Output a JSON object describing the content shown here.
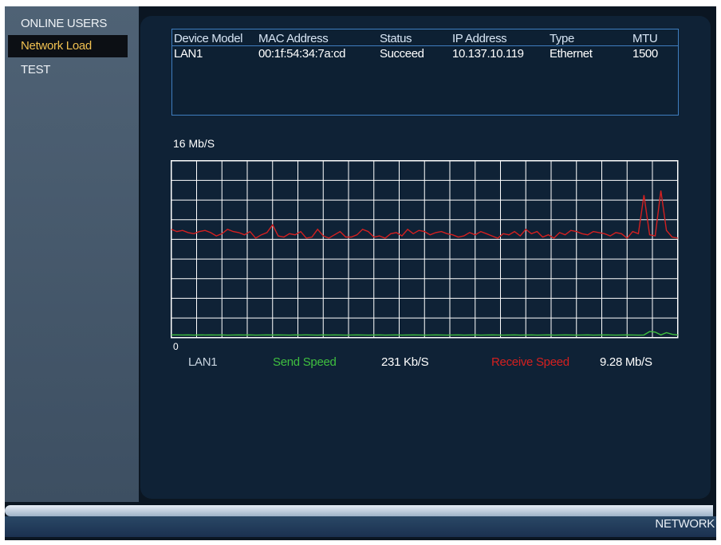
{
  "sidebar": {
    "items": [
      {
        "label": "ONLINE USERS",
        "active": false
      },
      {
        "label": "Network Load",
        "active": true
      },
      {
        "label": "TEST",
        "active": false
      }
    ]
  },
  "info_table": {
    "headers": [
      "Device Model",
      "MAC Address",
      "Status",
      "IP Address",
      "Type",
      "MTU"
    ],
    "rows": [
      [
        "LAN1",
        "00:1f:54:34:7a:cd",
        "Succeed",
        "10.137.10.119",
        "Ethernet",
        "1500"
      ]
    ]
  },
  "chart_data": {
    "type": "line",
    "y_max_label": "16 Mb/S",
    "y_min_label": "0",
    "ylim": [
      0,
      16
    ],
    "grid": true,
    "colors": {
      "send": "#3fbf3f",
      "receive": "#d42020",
      "grid": "#ffffff"
    },
    "series": [
      {
        "name": "Receive Speed",
        "color": "#d42020",
        "values": [
          9.8,
          9.6,
          9.7,
          9.5,
          9.4,
          9.6,
          9.7,
          9.5,
          9.2,
          9.4,
          9.8,
          9.6,
          9.5,
          9.3,
          9.6,
          9.0,
          9.3,
          9.5,
          10.2,
          9.2,
          9.1,
          9.4,
          9.3,
          9.6,
          9.0,
          9.1,
          9.8,
          9.2,
          9.0,
          9.3,
          9.6,
          9.1,
          9.1,
          9.3,
          9.8,
          9.6,
          9.1,
          9.2,
          9.0,
          9.4,
          9.5,
          9.2,
          9.8,
          9.4,
          9.7,
          9.6,
          9.3,
          9.5,
          9.6,
          9.4,
          9.3,
          9.1,
          9.2,
          9.5,
          9.3,
          9.6,
          9.4,
          9.2,
          9.0,
          9.4,
          9.3,
          9.6,
          9.2,
          9.8,
          9.4,
          9.6,
          9.1,
          9.3,
          9.0,
          9.5,
          9.3,
          9.7,
          9.6,
          9.4,
          9.3,
          9.6,
          9.5,
          9.4,
          9.2,
          9.5,
          9.4,
          9.0,
          9.6,
          9.4,
          12.9,
          9.3,
          9.2,
          13.3,
          9.7,
          9.1,
          9.0
        ]
      },
      {
        "name": "Send Speed",
        "color": "#3fbf3f",
        "values": [
          0.25,
          0.25,
          0.24,
          0.25,
          0.23,
          0.25,
          0.24,
          0.25,
          0.24,
          0.25,
          0.23,
          0.24,
          0.25,
          0.24,
          0.25,
          0.23,
          0.24,
          0.25,
          0.24,
          0.25,
          0.24,
          0.23,
          0.25,
          0.24,
          0.25,
          0.24,
          0.23,
          0.25,
          0.24,
          0.25,
          0.24,
          0.23,
          0.24,
          0.25,
          0.24,
          0.23,
          0.24,
          0.25,
          0.23,
          0.24,
          0.25,
          0.23,
          0.24,
          0.25,
          0.24,
          0.23,
          0.24,
          0.25,
          0.24,
          0.23,
          0.24,
          0.25,
          0.23,
          0.24,
          0.25,
          0.23,
          0.24,
          0.25,
          0.24,
          0.23,
          0.24,
          0.25,
          0.23,
          0.24,
          0.25,
          0.23,
          0.24,
          0.25,
          0.23,
          0.24,
          0.25,
          0.24,
          0.23,
          0.24,
          0.25,
          0.23,
          0.24,
          0.25,
          0.24,
          0.23,
          0.24,
          0.25,
          0.24,
          0.23,
          0.24,
          0.55,
          0.5,
          0.25,
          0.45,
          0.3,
          0.24
        ]
      }
    ]
  },
  "legend": {
    "interface": "LAN1",
    "send_label": "Send Speed",
    "send_value": "231 Kb/S",
    "receive_label": "Receive Speed",
    "receive_value": "9.28 Mb/S"
  },
  "footer": {
    "label": "NETWORK"
  }
}
